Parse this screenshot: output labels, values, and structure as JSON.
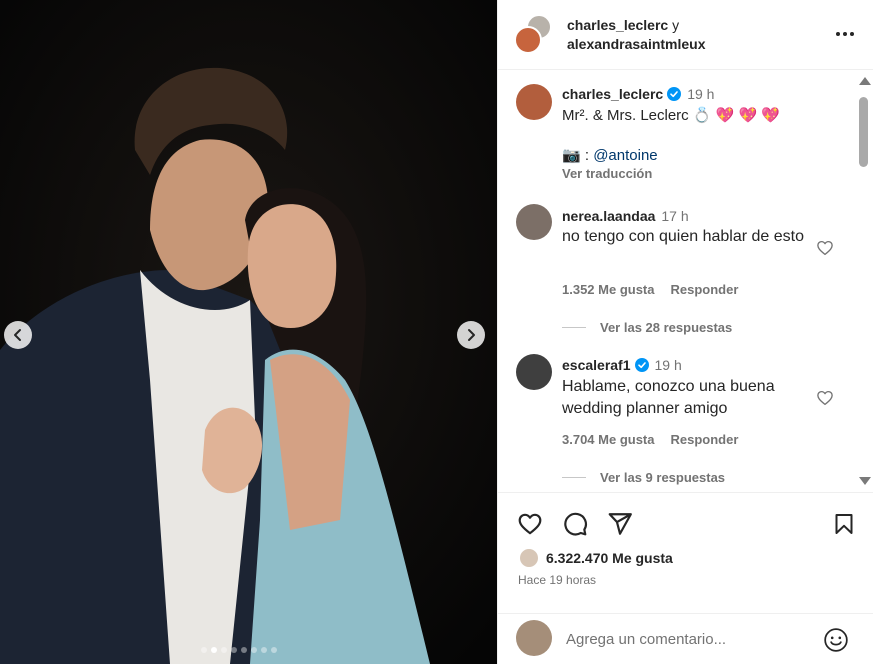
{
  "header": {
    "owner1": "charles_leclerc",
    "connector": "y",
    "owner2": "alexandrasaintmleux"
  },
  "carousel": {
    "total_slides": 8,
    "current_slide": 2
  },
  "caption": {
    "username": "charles_leclerc",
    "verified": true,
    "time": "19 h",
    "text": "Mr². & Mrs. Leclerc 💍 💖 💖 💖",
    "credit_prefix": "📷 :",
    "credit_mention": "@antoine",
    "translate_label": "Ver traducción"
  },
  "comments": [
    {
      "username": "nerea.laandaa",
      "verified": false,
      "time": "17 h",
      "text": "no tengo con quien hablar de esto",
      "likes": "1.352 Me gusta",
      "reply_label": "Responder",
      "view_replies": "Ver las 28 respuestas"
    },
    {
      "username": "escaleraf1",
      "verified": true,
      "time": "19 h",
      "text": "Hablame, conozco una buena wedding planner amigo",
      "likes": "3.704 Me gusta",
      "reply_label": "Responder",
      "view_replies": "Ver las 9 respuestas"
    }
  ],
  "footer": {
    "likes_count": "6.322.470 Me gusta",
    "posted_ago": "Hace 19 horas",
    "comment_placeholder": "Agrega un comentario..."
  },
  "icons": {
    "like": "heart-icon",
    "comment": "comment-icon",
    "share": "paper-plane-icon",
    "save": "bookmark-icon",
    "emoji": "smiley-icon",
    "more": "more-horizontal-icon"
  },
  "colors": {
    "verified_badge": "#0095f6",
    "mention": "#00376b",
    "secondary_text": "#737373"
  }
}
